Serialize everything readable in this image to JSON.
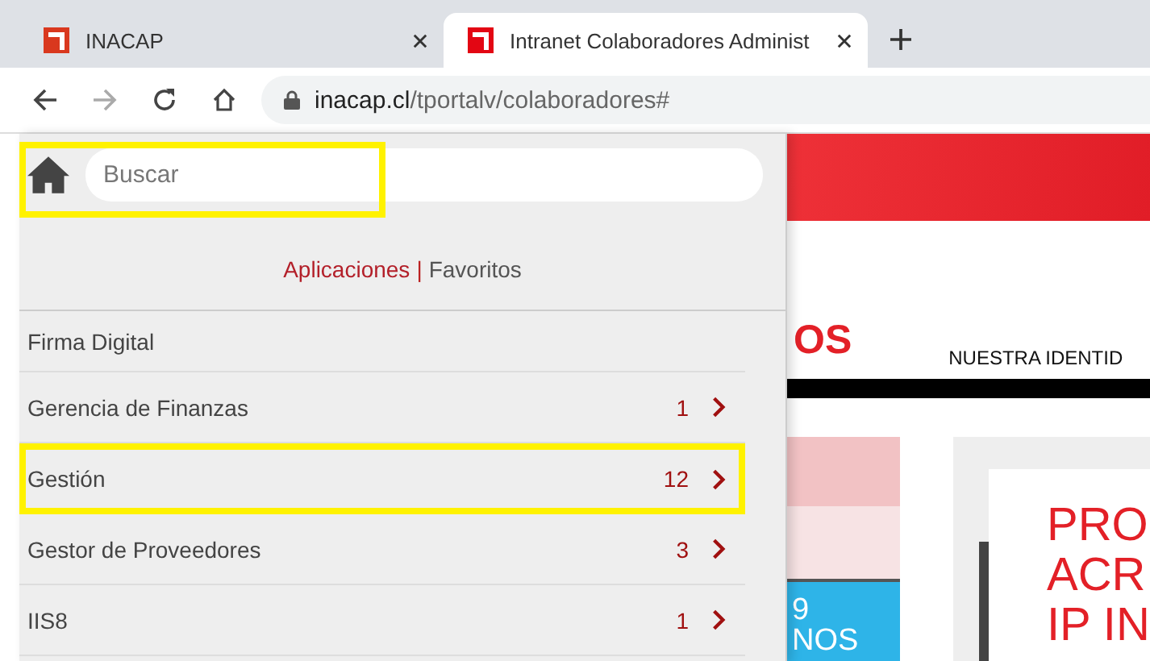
{
  "browser": {
    "tabs": [
      {
        "title": "INACAP",
        "selected": false
      },
      {
        "title": "Intranet Colaboradores Administ",
        "selected": true
      }
    ],
    "url": {
      "domain": "inacap.cl",
      "path": "/tportalv/colaboradores#"
    }
  },
  "menu": {
    "search": {
      "placeholder": "Buscar",
      "highlighted": true
    },
    "sections": [
      {
        "label": "Aplicaciones",
        "selected": true
      },
      {
        "label": "Favoritos",
        "selected": false
      }
    ],
    "separator": "|",
    "items": [
      {
        "label": "Firma Digital",
        "highlighted": false
      },
      {
        "label": "Gerencia de Finanzas",
        "count": "1",
        "highlighted": false
      },
      {
        "label": "Gestión",
        "count": "12",
        "highlighted": true
      },
      {
        "label": "Gestor de Proveedores",
        "count": "3",
        "highlighted": false
      },
      {
        "label": "IIS8",
        "count": "1",
        "highlighted": false
      }
    ]
  },
  "page": {
    "heading": "OS",
    "nav_item": "NUESTRA IDENTID",
    "tile_text": [
      "9",
      "NOS"
    ],
    "card_lines": [
      "PRO",
      "ACR",
      "IP IN"
    ]
  }
}
